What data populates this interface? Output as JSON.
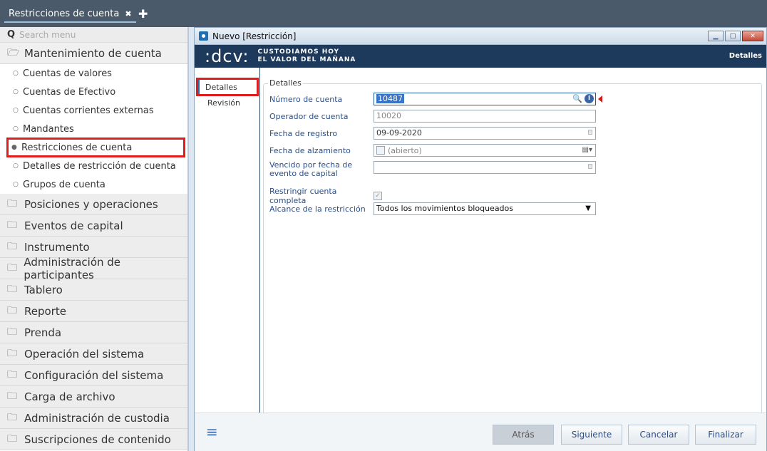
{
  "topbar": {
    "tab_label": "Restricciones de cuenta",
    "tab_close": "✖",
    "add_tab": "✚"
  },
  "sidebar": {
    "search_placeholder": "Search menu",
    "open_folder": "Mantenimiento de cuenta",
    "sub_items": [
      "Cuentas de valores",
      "Cuentas de Efectivo",
      "Cuentas corrientes externas",
      "Mandantes",
      "Restricciones de cuenta",
      "Detalles de restricción de cuenta",
      "Grupos de cuenta"
    ],
    "folders": [
      "Posiciones y operaciones",
      "Eventos de capital",
      "Instrumento",
      "Administración de participantes",
      "Tablero",
      "Reporte",
      "Prenda",
      "Operación del sistema",
      "Configuración del sistema",
      "Carga de archivo",
      "Administración de custodia",
      "Suscripciones de contenido"
    ]
  },
  "window": {
    "title": "Nuevo [Restricción]",
    "banner": {
      "logo": ":dcv:",
      "tagline_1": "CUSTODIAMOS HOY",
      "tagline_2": "EL VALOR DEL MAÑANA",
      "right": "Detalles"
    },
    "nav": [
      "Detalles",
      "Revisión"
    ],
    "legend": "Detalles",
    "fields": {
      "numero_cuenta": {
        "label": "Número de cuenta",
        "value": "10487"
      },
      "operador": {
        "label": "Operador de cuenta",
        "value": "10020"
      },
      "fecha_registro": {
        "label": "Fecha de registro",
        "value": "09-09-2020"
      },
      "fecha_alzamiento": {
        "label": "Fecha de alzamiento",
        "value": "(abierto)"
      },
      "vencido": {
        "label": "Vencido por fecha de evento de capital",
        "value": ""
      },
      "restringir": {
        "label": "Restringir cuenta completa",
        "checked": true
      },
      "alcance": {
        "label": "Alcance de la restricción",
        "value": "Todos los movimientos bloqueados"
      }
    },
    "buttons": {
      "back": "Atrás",
      "next": "Siguiente",
      "cancel": "Cancelar",
      "finish": "Finalizar"
    }
  },
  "colors": {
    "topbar": "#4a5a6a",
    "banner": "#1d3a5c",
    "highlight": "#e01c1c"
  }
}
